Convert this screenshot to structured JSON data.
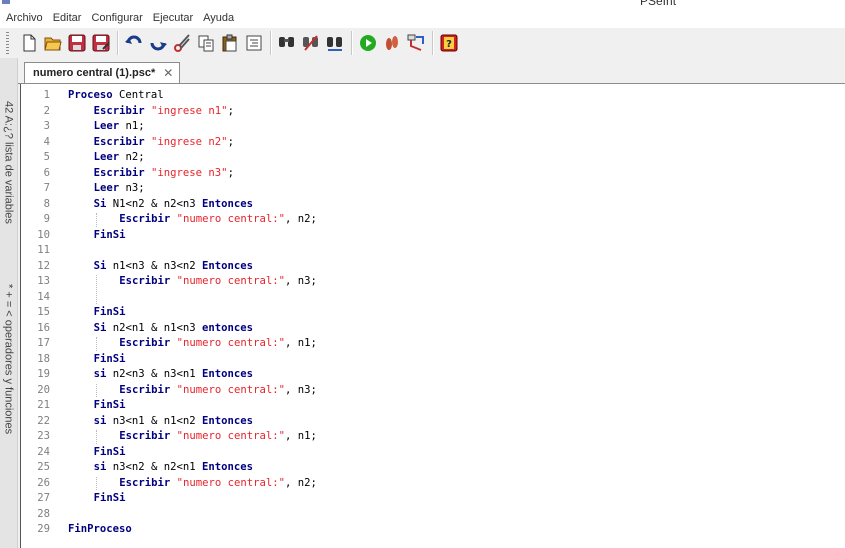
{
  "window": {
    "title": "PSeInt"
  },
  "menu": [
    "Archivo",
    "Editar",
    "Configurar",
    "Ejecutar",
    "Ayuda"
  ],
  "toolbar": {
    "icons": [
      "new-file-icon",
      "open-folder-icon",
      "save-icon",
      "save-as-icon",
      "undo-icon",
      "redo-icon",
      "cut-icon",
      "copy-icon",
      "paste-icon",
      "indent-icon",
      "search-icon",
      "replace-icon",
      "run-icon",
      "step-icon",
      "flowchart-icon",
      "help-icon"
    ],
    "colors": {
      "run": "#22aa22",
      "help": "#d02020",
      "save": "#c03040"
    }
  },
  "sidebar": {
    "variables_tab": "42 A:¿? lista de variables",
    "operators_tab": "* + = < operadores y funciones"
  },
  "editor": {
    "tab_label": "numero central (1).psc*",
    "tab_close": "✕",
    "lines": [
      {
        "n": "1",
        "indent": 0,
        "segs": [
          [
            "kw",
            "Proceso"
          ],
          [
            "pl",
            " Central"
          ]
        ]
      },
      {
        "n": "2",
        "indent": 1,
        "segs": [
          [
            "kw",
            "Escribir"
          ],
          [
            "pl",
            " "
          ],
          [
            "str",
            "\"ingrese n1\""
          ],
          [
            "pl",
            ";"
          ]
        ]
      },
      {
        "n": "3",
        "indent": 1,
        "segs": [
          [
            "kw",
            "Leer"
          ],
          [
            "pl",
            " n1;"
          ]
        ]
      },
      {
        "n": "4",
        "indent": 1,
        "segs": [
          [
            "kw",
            "Escribir"
          ],
          [
            "pl",
            " "
          ],
          [
            "str",
            "\"ingrese n2\""
          ],
          [
            "pl",
            ";"
          ]
        ]
      },
      {
        "n": "5",
        "indent": 1,
        "segs": [
          [
            "kw",
            "Leer"
          ],
          [
            "pl",
            " n2;"
          ]
        ]
      },
      {
        "n": "6",
        "indent": 1,
        "segs": [
          [
            "kw",
            "Escribir"
          ],
          [
            "pl",
            " "
          ],
          [
            "str",
            "\"ingrese n3\""
          ],
          [
            "pl",
            ";"
          ]
        ]
      },
      {
        "n": "7",
        "indent": 1,
        "segs": [
          [
            "kw",
            "Leer"
          ],
          [
            "pl",
            " n3;"
          ]
        ]
      },
      {
        "n": "8",
        "indent": 1,
        "segs": [
          [
            "kw",
            "Si"
          ],
          [
            "pl",
            " N1<n2 & n2<n3 "
          ],
          [
            "kw",
            "Entonces"
          ]
        ]
      },
      {
        "n": "9",
        "indent": 2,
        "segs": [
          [
            "kw",
            "Escribir"
          ],
          [
            "pl",
            " "
          ],
          [
            "str",
            "\"numero central:\""
          ],
          [
            "pl",
            ", n2;"
          ]
        ]
      },
      {
        "n": "10",
        "indent": 1,
        "segs": [
          [
            "kw",
            "FinSi"
          ]
        ]
      },
      {
        "n": "11",
        "indent": 0,
        "segs": []
      },
      {
        "n": "12",
        "indent": 1,
        "segs": [
          [
            "kw",
            "Si"
          ],
          [
            "pl",
            " n1<n3 & n3<n2 "
          ],
          [
            "kw",
            "Entonces"
          ]
        ]
      },
      {
        "n": "13",
        "indent": 2,
        "segs": [
          [
            "kw",
            "Escribir"
          ],
          [
            "pl",
            " "
          ],
          [
            "str",
            "\"numero central:\""
          ],
          [
            "pl",
            ", n3;"
          ]
        ]
      },
      {
        "n": "14",
        "indent": 0,
        "segs": []
      },
      {
        "n": "15",
        "indent": 1,
        "segs": [
          [
            "kw",
            "FinSi"
          ]
        ]
      },
      {
        "n": "16",
        "indent": 1,
        "segs": [
          [
            "kw",
            "Si"
          ],
          [
            "pl",
            " n2<n1 & n1<n3 "
          ],
          [
            "kw",
            "entonces"
          ]
        ]
      },
      {
        "n": "17",
        "indent": 2,
        "segs": [
          [
            "kw",
            "Escribir"
          ],
          [
            "pl",
            " "
          ],
          [
            "str",
            "\"numero central:\""
          ],
          [
            "pl",
            ", n1;"
          ]
        ]
      },
      {
        "n": "18",
        "indent": 1,
        "segs": [
          [
            "kw",
            "FinSi"
          ]
        ]
      },
      {
        "n": "19",
        "indent": 1,
        "segs": [
          [
            "kw",
            "si"
          ],
          [
            "pl",
            " n2<n3 & n3<n1 "
          ],
          [
            "kw",
            "Entonces"
          ]
        ]
      },
      {
        "n": "20",
        "indent": 2,
        "segs": [
          [
            "kw",
            "Escribir"
          ],
          [
            "pl",
            " "
          ],
          [
            "str",
            "\"numero central:\""
          ],
          [
            "pl",
            ", n3;"
          ]
        ]
      },
      {
        "n": "21",
        "indent": 1,
        "segs": [
          [
            "kw",
            "FinSi"
          ]
        ]
      },
      {
        "n": "22",
        "indent": 1,
        "segs": [
          [
            "kw",
            "si"
          ],
          [
            "pl",
            " n3<n1 & n1<n2 "
          ],
          [
            "kw",
            "Entonces"
          ]
        ]
      },
      {
        "n": "23",
        "indent": 2,
        "segs": [
          [
            "kw",
            "Escribir"
          ],
          [
            "pl",
            " "
          ],
          [
            "str",
            "\"numero central:\""
          ],
          [
            "pl",
            ", n1;"
          ]
        ]
      },
      {
        "n": "24",
        "indent": 1,
        "segs": [
          [
            "kw",
            "FinSi"
          ]
        ]
      },
      {
        "n": "25",
        "indent": 1,
        "segs": [
          [
            "kw",
            "si"
          ],
          [
            "pl",
            " n3<n2 & n2<n1 "
          ],
          [
            "kw",
            "Entonces"
          ]
        ]
      },
      {
        "n": "26",
        "indent": 2,
        "segs": [
          [
            "kw",
            "Escribir"
          ],
          [
            "pl",
            " "
          ],
          [
            "str",
            "\"numero central:\""
          ],
          [
            "pl",
            ", n2;"
          ]
        ]
      },
      {
        "n": "27",
        "indent": 1,
        "segs": [
          [
            "kw",
            "FinSi"
          ]
        ]
      },
      {
        "n": "28",
        "indent": 0,
        "segs": []
      },
      {
        "n": "29",
        "indent": 0,
        "segs": [
          [
            "kw",
            "FinProceso"
          ]
        ]
      }
    ]
  }
}
